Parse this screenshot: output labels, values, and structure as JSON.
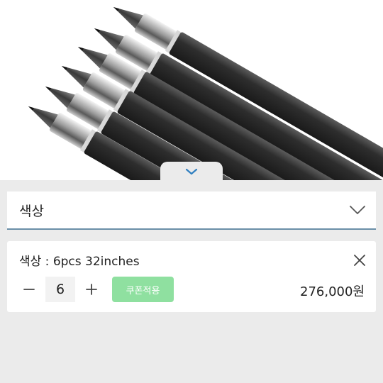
{
  "product_image": {
    "alt_icon": "pen-set-photo"
  },
  "collapse_toggle": {
    "icon": "chevron-down-icon"
  },
  "color_select": {
    "label": "색상",
    "icon": "chevron-down-icon"
  },
  "selected_option": {
    "name": "색상 : 6pcs 32inches",
    "quantity": "6",
    "decrease_icon": "minus-icon",
    "increase_icon": "plus-icon",
    "coupon_label": "쿠폰적용",
    "price": "276,000원",
    "remove_icon": "close-icon"
  },
  "colors": {
    "coupon": "#8fe0a0",
    "select_underline": "#6a8fa8",
    "chevron": "#2f7fc0"
  }
}
